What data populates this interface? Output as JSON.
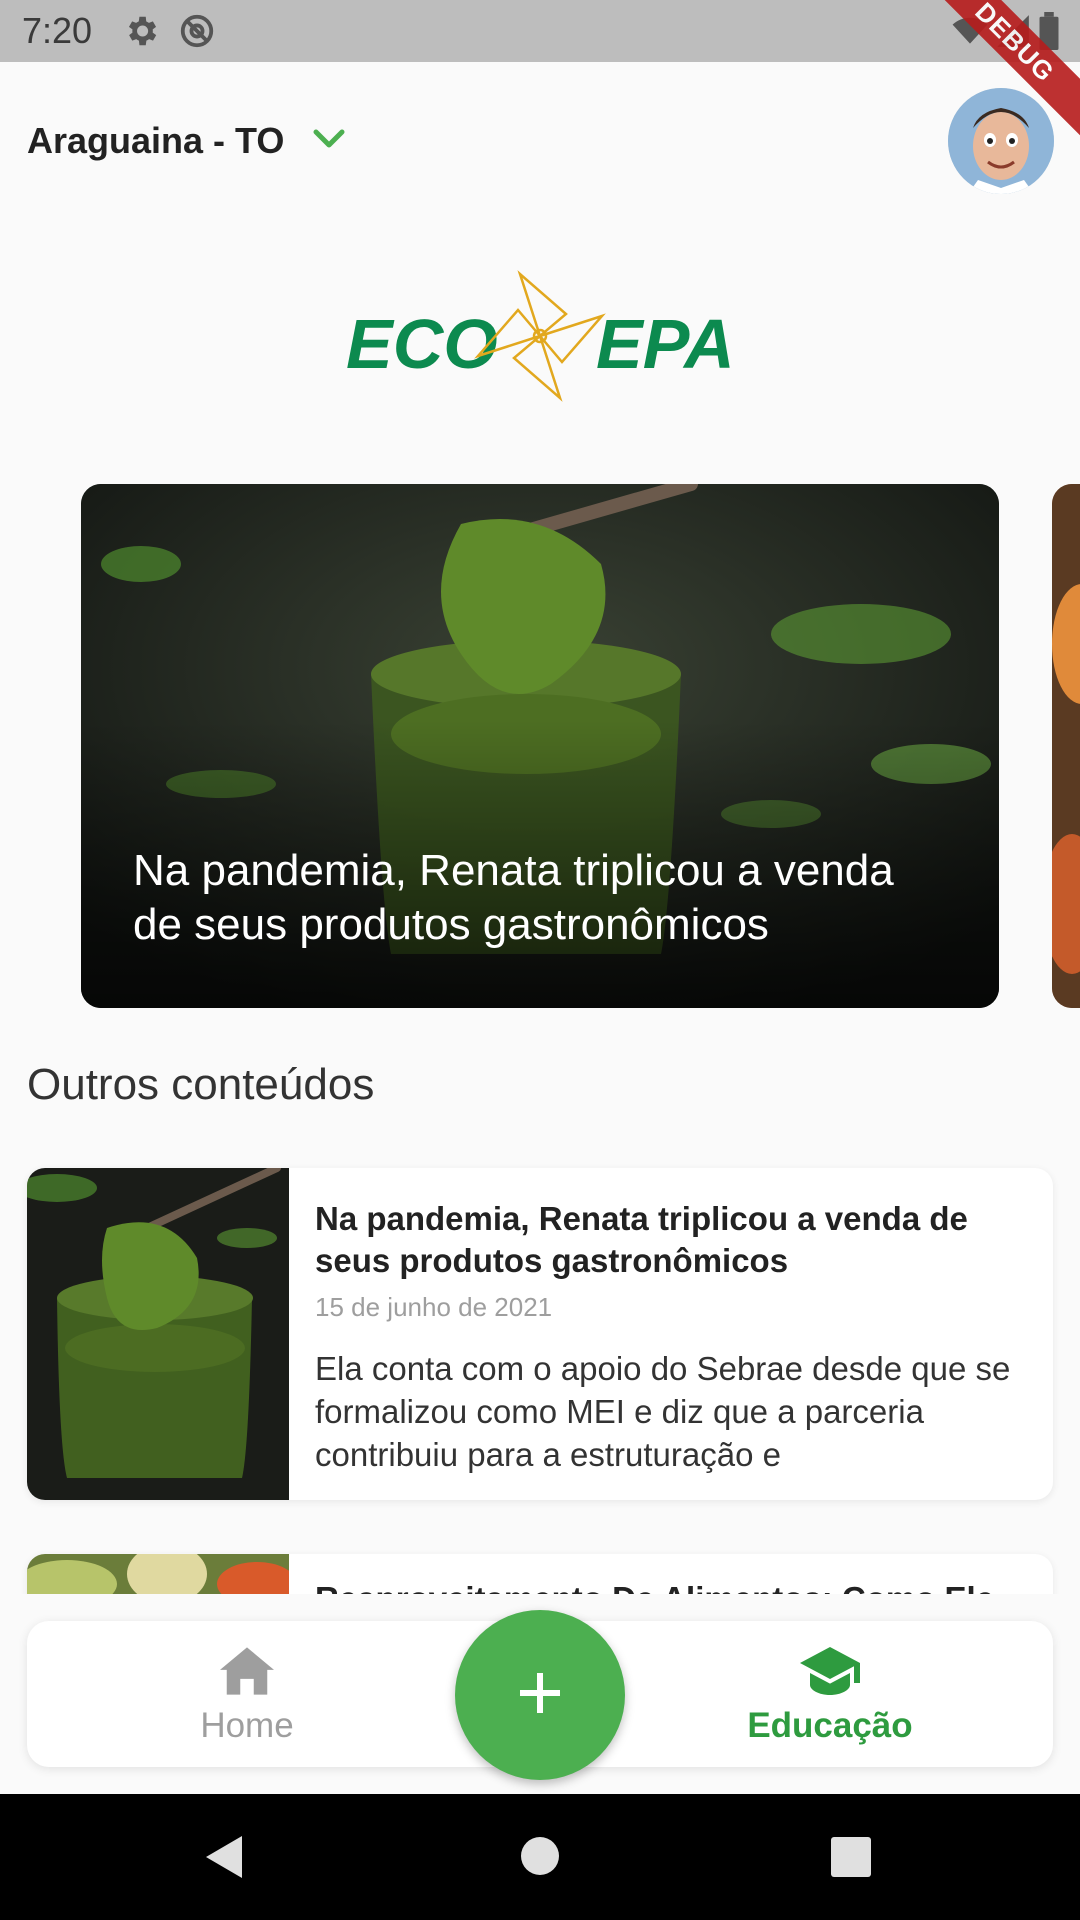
{
  "status_bar": {
    "time": "7:20",
    "icons": [
      "settings-icon",
      "at-sign-icon",
      "wifi-icon",
      "signal-icon",
      "battery-icon"
    ],
    "debug_banner": "DEBUG"
  },
  "header": {
    "location": "Araguaina - TO",
    "location_chevron_icon": "chevron-down-icon",
    "avatar_icon": "user-avatar"
  },
  "logo": {
    "left_text": "ECO",
    "right_text": "EPA",
    "emblem_icon": "pinwheel-icon"
  },
  "carousel": {
    "items": [
      {
        "title": "Na pandemia, Renata triplicou a venda de seus produtos gastronômicos"
      }
    ]
  },
  "section": {
    "title": "Outros conteúdos"
  },
  "content_list": [
    {
      "title": "Na pandemia, Renata triplicou a venda de seus produtos gastronômicos",
      "date": "15 de junho de 2021",
      "description": "Ela conta com o apoio do Sebrae desde que se formalizou como MEI e diz que a parceria contribuiu para a estruturação e"
    },
    {
      "title": "Reaproveitamento De Alimentos: Como Ele"
    }
  ],
  "bottom_nav": {
    "items": [
      {
        "label": "Home",
        "icon": "home-icon",
        "active": false
      },
      {
        "label": "Educação",
        "icon": "graduation-cap-icon",
        "active": true
      }
    ],
    "fab_icon": "plus-icon"
  },
  "system_nav": {
    "icons": [
      "back-icon",
      "home-circle-icon",
      "recents-icon"
    ]
  },
  "colors": {
    "accent": "#4caf50",
    "brand_green": "#0c8a4f",
    "brand_gold": "#e2a81e",
    "inactive": "#9e9e9e",
    "status_bar": "#bdbdbd"
  }
}
